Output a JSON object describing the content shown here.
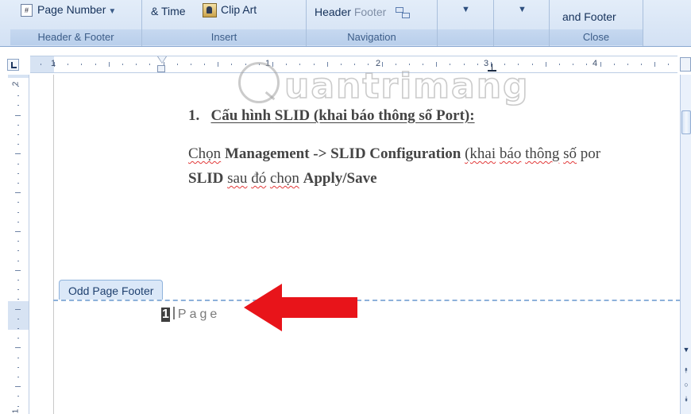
{
  "ribbon": {
    "header_footer_group": {
      "page_number_label": "Page Number",
      "page_number_icon": "page-number-icon",
      "title": "Header & Footer"
    },
    "insert_group": {
      "date_time_label": "& Time",
      "clip_art_label": "Clip Art",
      "clip_art_icon": "clip-art-icon",
      "title": "Insert"
    },
    "navigation_group": {
      "header_label": "Header",
      "footer_label": "Footer",
      "title": "Navigation"
    },
    "close_group": {
      "button_label": "and Footer",
      "title": "Close"
    }
  },
  "ruler": {
    "numbers": [
      "1",
      "1",
      "2",
      "3",
      "4"
    ]
  },
  "vertical_ruler": {
    "numbers": [
      "2",
      "1"
    ]
  },
  "document": {
    "heading_number": "1.",
    "heading_parts": [
      "Cấu hình",
      " SLID (khai báo thông số Port):"
    ],
    "para_line1": {
      "w1": "Chọn",
      "b1": "Management -> SLID Configuration",
      "w2": "(khai",
      "w3": "báo",
      "w4": "thông",
      "w5": "số",
      "w6": "por"
    },
    "para_line2": {
      "b1": "SLID",
      "w1": "sau",
      "w2": "đó",
      "w3": "chọn",
      "b2": "Apply/Save"
    },
    "watermark_text": "uantrimang"
  },
  "footer": {
    "tab_label": "Odd Page Footer",
    "page_number": "1",
    "page_text": "Page"
  },
  "colors": {
    "arrow": "#e8141a",
    "ribbon": "#dbe7f7",
    "footer_tab": "#dbe8f8"
  }
}
